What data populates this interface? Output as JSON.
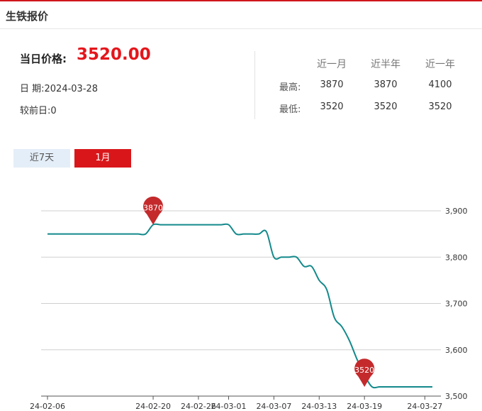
{
  "header": {
    "title": "生铁报价"
  },
  "summary": {
    "today_label": "当日价格:",
    "today_price": "3520.00",
    "date_text": "日  期:2024-03-28",
    "prev_text": "较前日:0"
  },
  "stats": {
    "columns": [
      "近一月",
      "近半年",
      "近一年"
    ],
    "rows": [
      {
        "label": "最高:",
        "values": [
          "3870",
          "3870",
          "4100"
        ]
      },
      {
        "label": "最低:",
        "values": [
          "3520",
          "3520",
          "3520"
        ]
      }
    ]
  },
  "tabs": [
    {
      "label": "近7天",
      "active": false
    },
    {
      "label": "1月",
      "active": true
    }
  ],
  "colors": {
    "line": "#13898b",
    "pin": "#c42a2c",
    "active_tab": "#d9171b",
    "brand": "#d0161b"
  },
  "chart_data": {
    "type": "line",
    "x": [
      "2024-02-06",
      "2024-02-07",
      "2024-02-08",
      "2024-02-09",
      "2024-02-10",
      "2024-02-11",
      "2024-02-12",
      "2024-02-13",
      "2024-02-14",
      "2024-02-15",
      "2024-02-16",
      "2024-02-17",
      "2024-02-18",
      "2024-02-19",
      "2024-02-20",
      "2024-02-21",
      "2024-02-22",
      "2024-02-23",
      "2024-02-24",
      "2024-02-25",
      "2024-02-26",
      "2024-02-27",
      "2024-02-28",
      "2024-02-29",
      "2024-03-01",
      "2024-03-02",
      "2024-03-03",
      "2024-03-04",
      "2024-03-05",
      "2024-03-06",
      "2024-03-07",
      "2024-03-08",
      "2024-03-09",
      "2024-03-10",
      "2024-03-11",
      "2024-03-12",
      "2024-03-13",
      "2024-03-14",
      "2024-03-15",
      "2024-03-16",
      "2024-03-17",
      "2024-03-18",
      "2024-03-19",
      "2024-03-20",
      "2024-03-21",
      "2024-03-22",
      "2024-03-23",
      "2024-03-24",
      "2024-03-25",
      "2024-03-26",
      "2024-03-27",
      "2024-03-28"
    ],
    "series": [
      {
        "values": [
          3850,
          3850,
          3850,
          3850,
          3850,
          3850,
          3850,
          3850,
          3850,
          3850,
          3850,
          3850,
          3850,
          3850,
          3870,
          3870,
          3870,
          3870,
          3870,
          3870,
          3870,
          3870,
          3870,
          3870,
          3870,
          3850,
          3850,
          3850,
          3850,
          3855,
          3800,
          3800,
          3800,
          3800,
          3780,
          3780,
          3750,
          3730,
          3670,
          3650,
          3620,
          3580,
          3545,
          3520,
          3520,
          3520,
          3520,
          3520,
          3520,
          3520,
          3520,
          3520
        ]
      }
    ],
    "x_tick_labels": [
      "24-02-06",
      "24-02-20",
      "24-02-26",
      "24-03-01",
      "24-03-07",
      "24-03-13",
      "24-03-19",
      "24-03-27"
    ],
    "y_tick_labels": [
      "3,500",
      "3,600",
      "3,700",
      "3,800",
      "3,900"
    ],
    "ylim": [
      3500,
      3900
    ],
    "annotations": [
      {
        "x": "2024-02-20",
        "y": 3870,
        "label": "3870"
      },
      {
        "x": "2024-03-19",
        "y": 3520,
        "label": "3520"
      }
    ],
    "grid": true
  }
}
